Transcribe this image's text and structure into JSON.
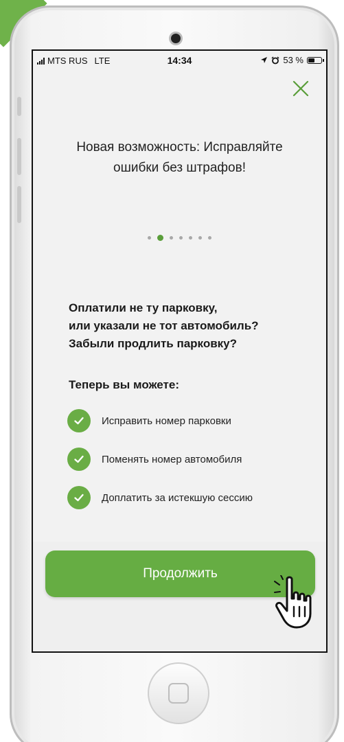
{
  "status": {
    "carrier": "MTS RUS",
    "network": "LTE",
    "time": "14:34",
    "battery": "53 %"
  },
  "onboarding": {
    "headline_line1": "Новая возможность: Исправляйте",
    "headline_line2": "ошибки без штрафов!",
    "page_count": 7,
    "active_page": 2,
    "question_line1": "Оплатили не ту парковку,",
    "question_line2": "или указали не тот автомобиль?",
    "question_line3": "Забыли продлить парковку?",
    "subtitle": "Теперь вы можете:",
    "features": [
      "Исправить номер парковки",
      "Поменять номер автомобиля",
      "Доплатить за истекшую сессию"
    ],
    "continue_label": "Продолжить"
  },
  "icons": {
    "close": "close-icon",
    "check": "check-icon",
    "pointer": "hand-pointer-icon"
  },
  "colors": {
    "accent": "#66ad43",
    "screen_bg": "#f2f2f2",
    "text": "#222222"
  }
}
